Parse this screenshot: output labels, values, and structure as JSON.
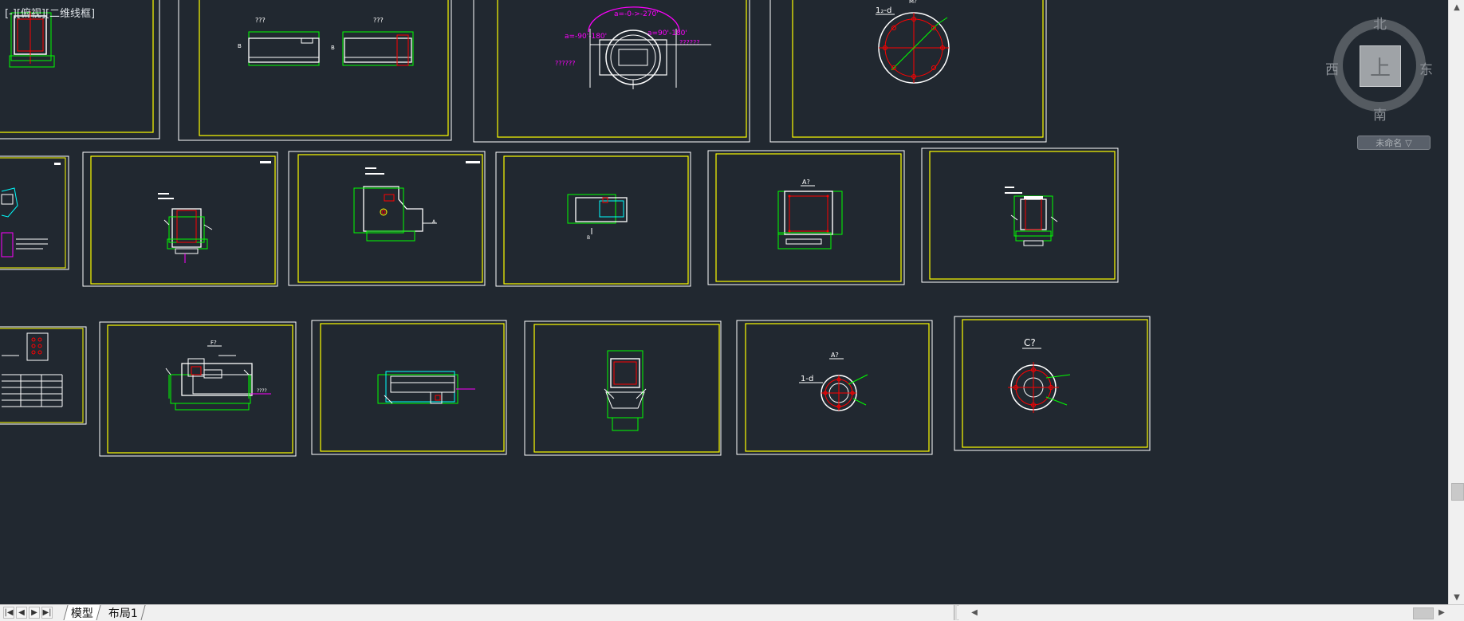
{
  "viewport": {
    "label": "[-][俯视][二维线框]"
  },
  "viewcube": {
    "north": "北",
    "south": "南",
    "east": "东",
    "west": "西",
    "top_face": "上",
    "wcs_label": "未命名",
    "icons": [
      "viewcube-ring",
      "chevron-down-icon"
    ]
  },
  "drawing_text": {
    "sheet_a_label_1": "???",
    "sheet_a_label_2": "???",
    "sheet_a_mark_b1": "B",
    "sheet_a_mark_b2": "B",
    "angle_top": "a=-0->-270'",
    "angle_left": "a=-90'-180'",
    "angle_right": "a=90'-180'",
    "dims_right": "??????",
    "dims_left": "??????",
    "flange_label": "1₂-d",
    "flange_title": "M?",
    "sheet_a9_title": "A?",
    "sheet_f_title": "F?",
    "sheet_f_dim": "????",
    "sheet_a9b_title": "A?",
    "sheet_ld_label": "1-d",
    "sheet_c7_title": "C?"
  },
  "tabs": {
    "model": "模型",
    "layout1": "布局1"
  },
  "nav_icons": [
    "first-tab-icon",
    "prev-tab-icon",
    "next-tab-icon",
    "last-tab-icon"
  ],
  "colors": {
    "background": "#212830",
    "sheet_border": "#ffffff",
    "sheet_frame": "#ffff00",
    "geometry": "#ffffff",
    "green": "#00ff00",
    "red": "#ff0000",
    "magenta": "#ff00ff",
    "cyan": "#00ffff"
  }
}
